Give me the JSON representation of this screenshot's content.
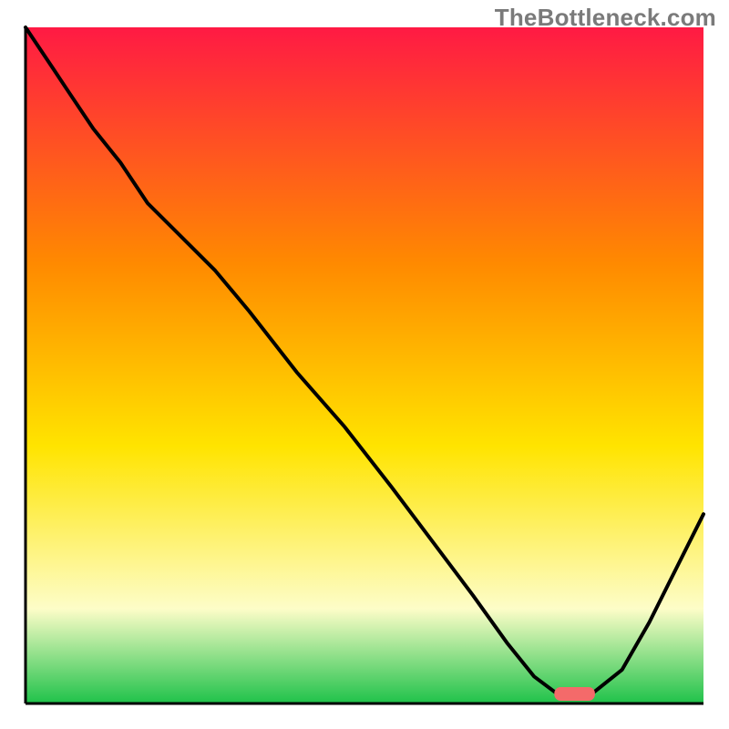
{
  "watermark": "TheBottleneck.com",
  "chart_data": {
    "type": "line",
    "title": "",
    "xlabel": "",
    "ylabel": "",
    "x": [
      0.0,
      0.04,
      0.06,
      0.1,
      0.14,
      0.18,
      0.24,
      0.28,
      0.33,
      0.4,
      0.47,
      0.54,
      0.6,
      0.66,
      0.71,
      0.75,
      0.79,
      0.83,
      0.88,
      0.92,
      0.96,
      1.0
    ],
    "values": [
      1.0,
      0.94,
      0.91,
      0.85,
      0.8,
      0.74,
      0.68,
      0.64,
      0.58,
      0.49,
      0.41,
      0.32,
      0.24,
      0.16,
      0.09,
      0.04,
      0.01,
      0.01,
      0.05,
      0.12,
      0.2,
      0.28
    ],
    "xlim": [
      0,
      1
    ],
    "ylim": [
      0,
      1
    ],
    "optimal_marker_x": [
      0.78,
      0.84
    ],
    "annotations": []
  },
  "colors": {
    "gradient_top": "#ff1a44",
    "gradient_mid1": "#ff8a00",
    "gradient_mid2": "#ffe400",
    "gradient_pale": "#fdfdc8",
    "gradient_green": "#1fc24a",
    "line": "#000000",
    "axis": "#000000",
    "marker": "#f46a6a"
  }
}
